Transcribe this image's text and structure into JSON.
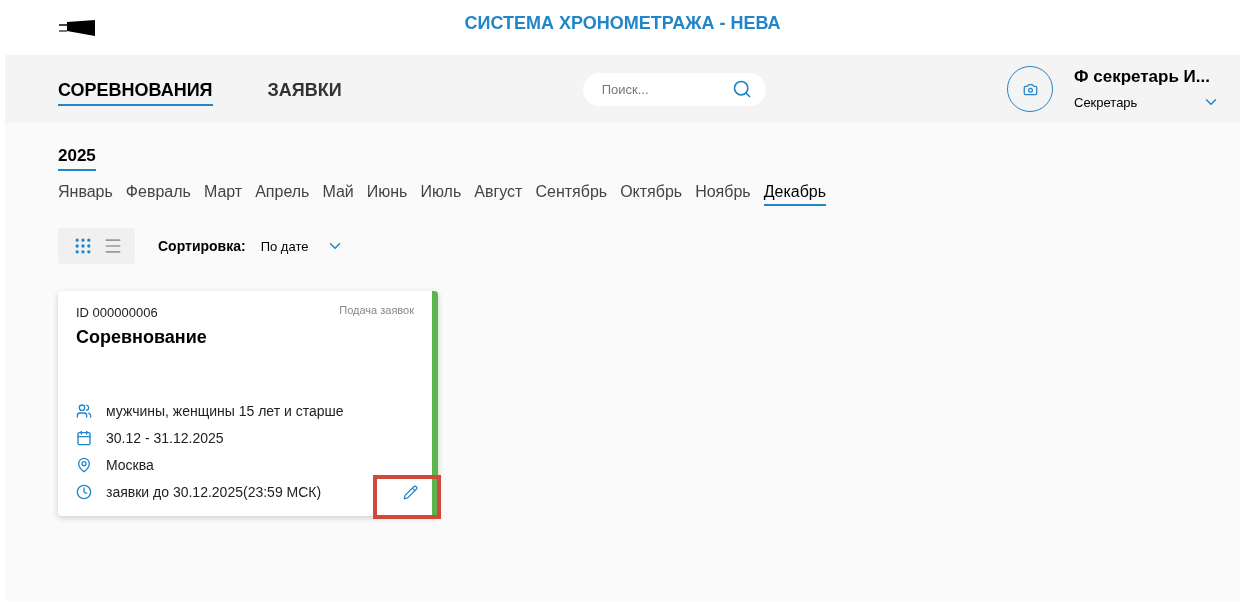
{
  "header": {
    "title": "СИСТЕМА ХРОНОМЕТРАЖА - НЕВА"
  },
  "nav": {
    "tabs": [
      {
        "label": "СОРЕВНОВАНИЯ",
        "selected": true
      },
      {
        "label": "ЗАЯВКИ",
        "selected": false
      }
    ],
    "search": {
      "placeholder": "Поиск..."
    },
    "user": {
      "name": "Ф секретарь И...",
      "role": "Секретарь"
    }
  },
  "year": {
    "label": "2025",
    "selected": true
  },
  "months": [
    {
      "label": "Январь",
      "selected": false
    },
    {
      "label": "Февраль",
      "selected": false
    },
    {
      "label": "Март",
      "selected": false
    },
    {
      "label": "Апрель",
      "selected": false
    },
    {
      "label": "Май",
      "selected": false
    },
    {
      "label": "Июнь",
      "selected": false
    },
    {
      "label": "Июль",
      "selected": false
    },
    {
      "label": "Август",
      "selected": false
    },
    {
      "label": "Сентябрь",
      "selected": false
    },
    {
      "label": "Октябрь",
      "selected": false
    },
    {
      "label": "Ноябрь",
      "selected": false
    },
    {
      "label": "Декабрь",
      "selected": true
    }
  ],
  "view_modes": [
    {
      "kind": "grid",
      "selected": true
    },
    {
      "kind": "list",
      "selected": false
    }
  ],
  "sort": {
    "label": "Сортировка:",
    "value": "По дате"
  },
  "cards": [
    {
      "id": "ID 000000006",
      "status": "Подача заявок",
      "color": "#5ab54a",
      "title": "Соревнование",
      "edit_highlighted": true,
      "details": [
        {
          "kind": "people",
          "text": "мужчины, женщины 15 лет и старше"
        },
        {
          "kind": "calendar",
          "text": "30.12 - 31.12.2025"
        },
        {
          "kind": "location",
          "text": "Москва"
        },
        {
          "kind": "clock",
          "text": "заявки до 30.12.2025(23:59 МСК)"
        }
      ]
    }
  ]
}
